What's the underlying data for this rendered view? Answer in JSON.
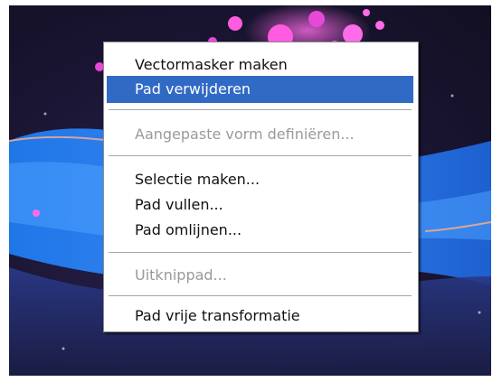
{
  "context_menu": {
    "items": [
      {
        "label": "Vectormasker maken"
      },
      {
        "label": "Pad verwijderen"
      },
      {
        "label": "Aangepaste vorm definiëren..."
      },
      {
        "label": "Selectie maken..."
      },
      {
        "label": "Pad vullen..."
      },
      {
        "label": "Pad omlijnen..."
      },
      {
        "label": "Uitknippad..."
      },
      {
        "label": "Pad vrije transformatie"
      }
    ],
    "highlight_color": "#316ac5",
    "disabled_text_color": "#9a9a9a"
  }
}
